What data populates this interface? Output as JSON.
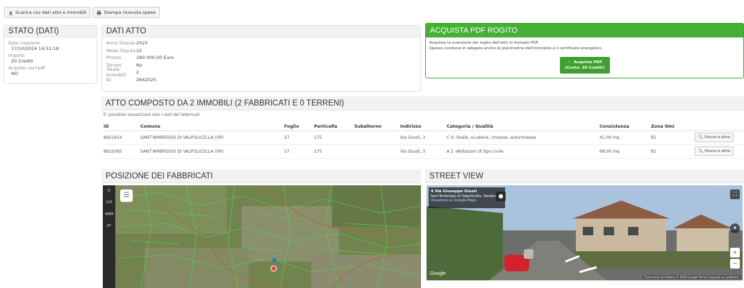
{
  "toolbar": {
    "download_label": "Scarica csv dati atto e immobili",
    "print_label": "Stampa ricevuta spese"
  },
  "stato": {
    "title": "STATO (DATI)",
    "items": [
      {
        "label": "Data creazione",
        "value": "17/10/2024 14:51:18"
      },
      {
        "label": "Importo",
        "value": "20 Crediti"
      },
      {
        "label": "Acquisto csv+pdf",
        "value": "NO"
      }
    ]
  },
  "atto": {
    "title": "DATI ATTO",
    "rows": [
      {
        "k": "Anno Stipula",
        "v": "2023"
      },
      {
        "k": "Mese Stipula",
        "v": "12"
      },
      {
        "k": "Prezzo",
        "v": "180.000,00 Euro"
      },
      {
        "k": "Terreni",
        "v": "No"
      },
      {
        "k": "Totale Immobili",
        "v": "2"
      },
      {
        "k": "ID",
        "v": "2642025"
      }
    ]
  },
  "acquista": {
    "title": "ACQUISTA PDF ROGITO",
    "line1": "Acquista la scansione del rogito dell'atto in formato PDF.",
    "line2": "Spesso contiene in allegato anche le planimetrie dell'immobile e il certificato energetico.",
    "button_line1": "Acquista PDF",
    "button_line2": "(Costo: 20 Crediti)"
  },
  "composto": {
    "title": "ATTO COMPOSTO DA 2 IMMOBILI (2 FABBRICATI E 0 TERRENI)",
    "note": "E' possibile visualizzare solo i dati dei fabbricati",
    "headers": [
      "ID",
      "Comune",
      "Foglio",
      "Particella",
      "Subalterno",
      "Indirizzo",
      "Categoria / Qualità",
      "Consistenza",
      "Zona Omi"
    ],
    "rows": [
      {
        "id": "8921914",
        "comune": "SANT'AMBROGIO DI VALPOLICELLA (VR)",
        "foglio": "27",
        "particella": "175",
        "sub": "",
        "indirizzo": "Via Giusti, 3",
        "categoria": "C 6 -Stalle, scuderie, rimesse, autorimesse",
        "consistenza": "41,00 mq",
        "zona": "B1",
        "btn": "Visura e altro"
      },
      {
        "id": "8922065",
        "comune": "SANT'AMBROGIO DI VALPOLICELLA (VR)",
        "foglio": "27",
        "particella": "175",
        "sub": "",
        "indirizzo": "Via Giusti, 3",
        "categoria": "A 2 -Abitazioni di tipo civile",
        "consistenza": "68.00 mq",
        "zona": "B1",
        "btn": "Visura e altro"
      }
    ]
  },
  "posizione": {
    "title": "POSIZIONE DEI FABBRICATI",
    "side": [
      "Q",
      "CAT",
      "AMM",
      "PF"
    ]
  },
  "street": {
    "title": "STREET VIEW",
    "card_title": "4 Via Giuseppe Giusti",
    "card_sub": "Sant'Ambrogio di Valpolicella, Veneto",
    "card_link": "Visualizza su Google Maps",
    "google": "Google",
    "copyright": "Scorciatoie da tastiera  © 2024 Google  Termini  Segnala un problema"
  },
  "colors": {
    "green": "#45b035",
    "panel_bg": "#f2f2f2"
  }
}
